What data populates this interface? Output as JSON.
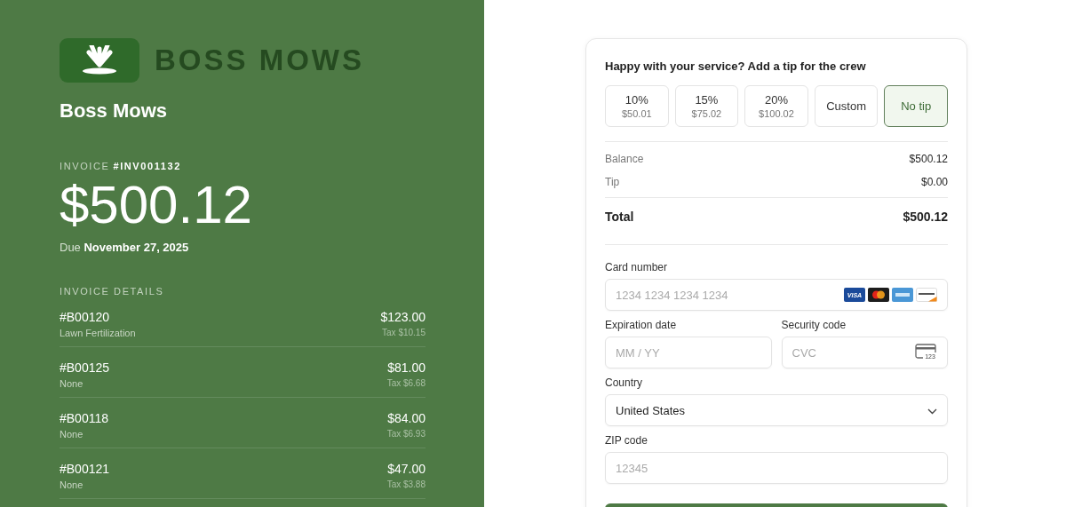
{
  "merchant": {
    "logo_text": "BOSS MOWS",
    "name": "Boss Mows"
  },
  "invoice": {
    "label": "INVOICE",
    "number": "#INV001132",
    "amount": "$500.12",
    "due_label": "Due",
    "due_date": "November 27, 2025"
  },
  "details": {
    "heading": "INVOICE DETAILS",
    "items": [
      {
        "id": "#B00120",
        "description": "Lawn Fertilization",
        "amount": "$123.00",
        "tax": "Tax $10.15"
      },
      {
        "id": "#B00125",
        "description": "None",
        "amount": "$81.00",
        "tax": "Tax $6.68"
      },
      {
        "id": "#B00118",
        "description": "None",
        "amount": "$84.00",
        "tax": "Tax $6.93"
      },
      {
        "id": "#B00121",
        "description": "None",
        "amount": "$47.00",
        "tax": "Tax $3.88"
      }
    ]
  },
  "tip": {
    "prompt": "Happy with your service? Add a tip for the crew",
    "options": [
      {
        "label": "10%",
        "amount": "$50.01",
        "selected": false
      },
      {
        "label": "15%",
        "amount": "$75.02",
        "selected": false
      },
      {
        "label": "20%",
        "amount": "$100.02",
        "selected": false
      },
      {
        "label": "Custom",
        "selected": false
      },
      {
        "label": "No tip",
        "selected": true
      }
    ]
  },
  "summary": [
    {
      "label": "Balance",
      "value": "$500.12",
      "kind": "line"
    },
    {
      "label": "Tip",
      "value": "$0.00",
      "kind": "line"
    },
    {
      "label": "Total",
      "value": "$500.12",
      "kind": "total"
    }
  ],
  "payment": {
    "card_label": "Card number",
    "card_placeholder": "1234 1234 1234 1234",
    "visa_text": "VISA",
    "expiry_label": "Expiration date",
    "expiry_placeholder": "MM / YY",
    "cvc_label": "Security code",
    "cvc_placeholder": "CVC",
    "cvc_icon_text": "123",
    "country_label": "Country",
    "country_value": "United States",
    "zip_label": "ZIP code",
    "zip_placeholder": "12345"
  }
}
